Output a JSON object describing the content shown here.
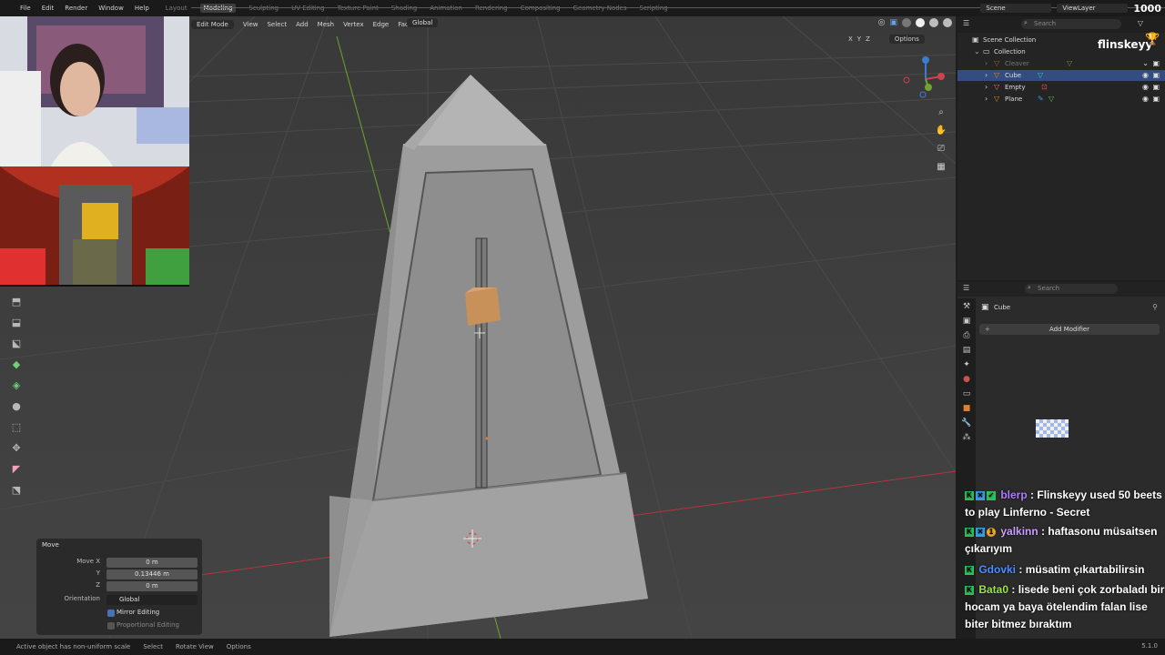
{
  "topbar": {
    "menus": [
      "File",
      "Edit",
      "Render",
      "Window",
      "Help"
    ],
    "workspaces": [
      "Layout",
      "Modeling",
      "Sculpting",
      "UV Editing",
      "Texture Paint",
      "Shading",
      "Animation",
      "Rendering",
      "Compositing",
      "Geometry Nodes",
      "Scripting"
    ],
    "active_workspace": "Modeling",
    "scene": "Scene",
    "view_layer": "ViewLayer",
    "count": "1000"
  },
  "viewport_header": {
    "mode": "Edit Mode",
    "menus": [
      "View",
      "Select",
      "Add",
      "Mesh",
      "Vertex",
      "Edge",
      "Face",
      "UV"
    ],
    "orientation": "Global",
    "axes": [
      "X",
      "Y",
      "Z"
    ],
    "options_label": "Options"
  },
  "move_panel": {
    "title": "Move",
    "move_x_label": "Move X",
    "move_x": "0 m",
    "y_label": "Y",
    "y": "0.13446 m",
    "z_label": "Z",
    "z": "0 m",
    "orientation_label": "Orientation",
    "orientation": "Global",
    "mirror_editing": "Mirror Editing",
    "mirror_checked": true,
    "proportional_editing": "Proportional Editing",
    "proportional_checked": false
  },
  "statusbar": {
    "message": "Active object has non-uniform scale",
    "select": "Select",
    "rotate_view": "Rotate View",
    "options": "Options",
    "version": "5.1.0"
  },
  "outliner": {
    "search_placeholder": "Search",
    "scene_collection": "Scene Collection",
    "collection": "Collection",
    "items": [
      {
        "name": "Cleaver",
        "dimmed": true,
        "selected": false
      },
      {
        "name": "Cube",
        "dimmed": false,
        "selected": true
      },
      {
        "name": "Empty",
        "dimmed": false,
        "selected": false
      },
      {
        "name": "Plane",
        "dimmed": false,
        "selected": false
      }
    ],
    "streamer_name": "flinskeyy"
  },
  "properties": {
    "search_placeholder": "Search",
    "object_name": "Cube",
    "add_modifier": "Add Modifier"
  },
  "chat": [
    {
      "user": "blerp",
      "user_color": "#b07cff",
      "text": "Flinskeyy used 50 beets to play Linferno - Secret"
    },
    {
      "user": "yalkinn",
      "user_color": "#c9a0ff",
      "text": "haftasonu müsaitsen çıkarıyım"
    },
    {
      "user": "Gdovki",
      "user_color": "#4a90ff",
      "text": "müsatim çıkartabilirsin"
    },
    {
      "user": "Bata0",
      "user_color": "#9be34a",
      "text": "lisede beni çok zorbaladı bir hocam ya baya ötelendim falan lise biter bitmez bıraktım"
    },
    {
      "user": "flinskeyy",
      "user_color": "#ff3060",
      "text": ""
    }
  ],
  "colors": {
    "accent_blue": "#4772b3",
    "selection": "#334d80",
    "viewport_bg": "#3d3d3d",
    "x_axis": "#b3343c",
    "y_axis": "#6ea52c"
  }
}
